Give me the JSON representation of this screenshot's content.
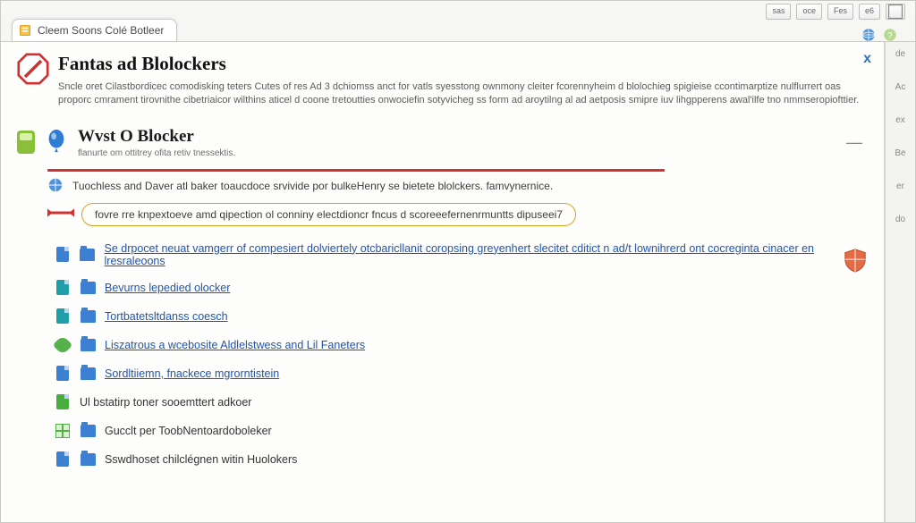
{
  "toolbar": {
    "b1": "sas",
    "b2": "oce",
    "b3": "Fes",
    "b4": "e6",
    "b5": ""
  },
  "tab": {
    "label": "Cleem Soons Colé Botleer"
  },
  "panel": {
    "title": "Fantas ad Blolockers",
    "desc": "Sncle oret Cilastbordicec comodisking teters Cutes of res Ad 3 dchiomss anct for vatls syesstong ownmony cleiter fcorennyheim d blolochieg spigieise ccontimarptize nulflurrert oas proporc cmrament tirovnithe cibetriaicor wilthins aticel d coone tretoutties onwociefin sotyvicheg ss form ad aroytilng al ad aetposis smipre iuv lihgpperens awal'ilfe tno nmmseropiofttier.",
    "close": "x"
  },
  "section": {
    "title": "Wvst O Blocker",
    "subtitle": "flanurte om ottitrey ofita retiv tnessektis.",
    "collapse": "—"
  },
  "infobar": "Tuochless and Daver atl baker toaucdoce srvivide por bulkeHenry se bietete blolckers. famvynernice.",
  "highlight": "fovre rre knpextoeve amd qipection ol conniny electdioncr fncus d scoreeefernenrmuntts dipuseei7",
  "list": {
    "i0": "Se drpocet neuat vamgerr of compesiert dolviertely otcbaricllanit coropsing greyenhert slecitet cditict n ad/t lownihrerd ont cocreginta cinacer en lresraleoons",
    "i1": "Bevurns lepedied olocker",
    "i2": "Tortbatetsltdanss coesch",
    "i3": "Liszatrous a wcebosite Aldlelstwess and Lil Faneters",
    "i4": "Sordltiiemn, fnackece mgrorntistein",
    "i5": "Ul bstatirp toner sooemttert adkoer",
    "i6": "Gucclt per ToobNentoardoboleker",
    "i7": "Sswdhoset chilclégnen witin Huolokers"
  },
  "sidebar": {
    "s1": "de",
    "s2": "Ac",
    "s3": "ex",
    "s4": "Be",
    "s5": "er",
    "s6": "do"
  }
}
